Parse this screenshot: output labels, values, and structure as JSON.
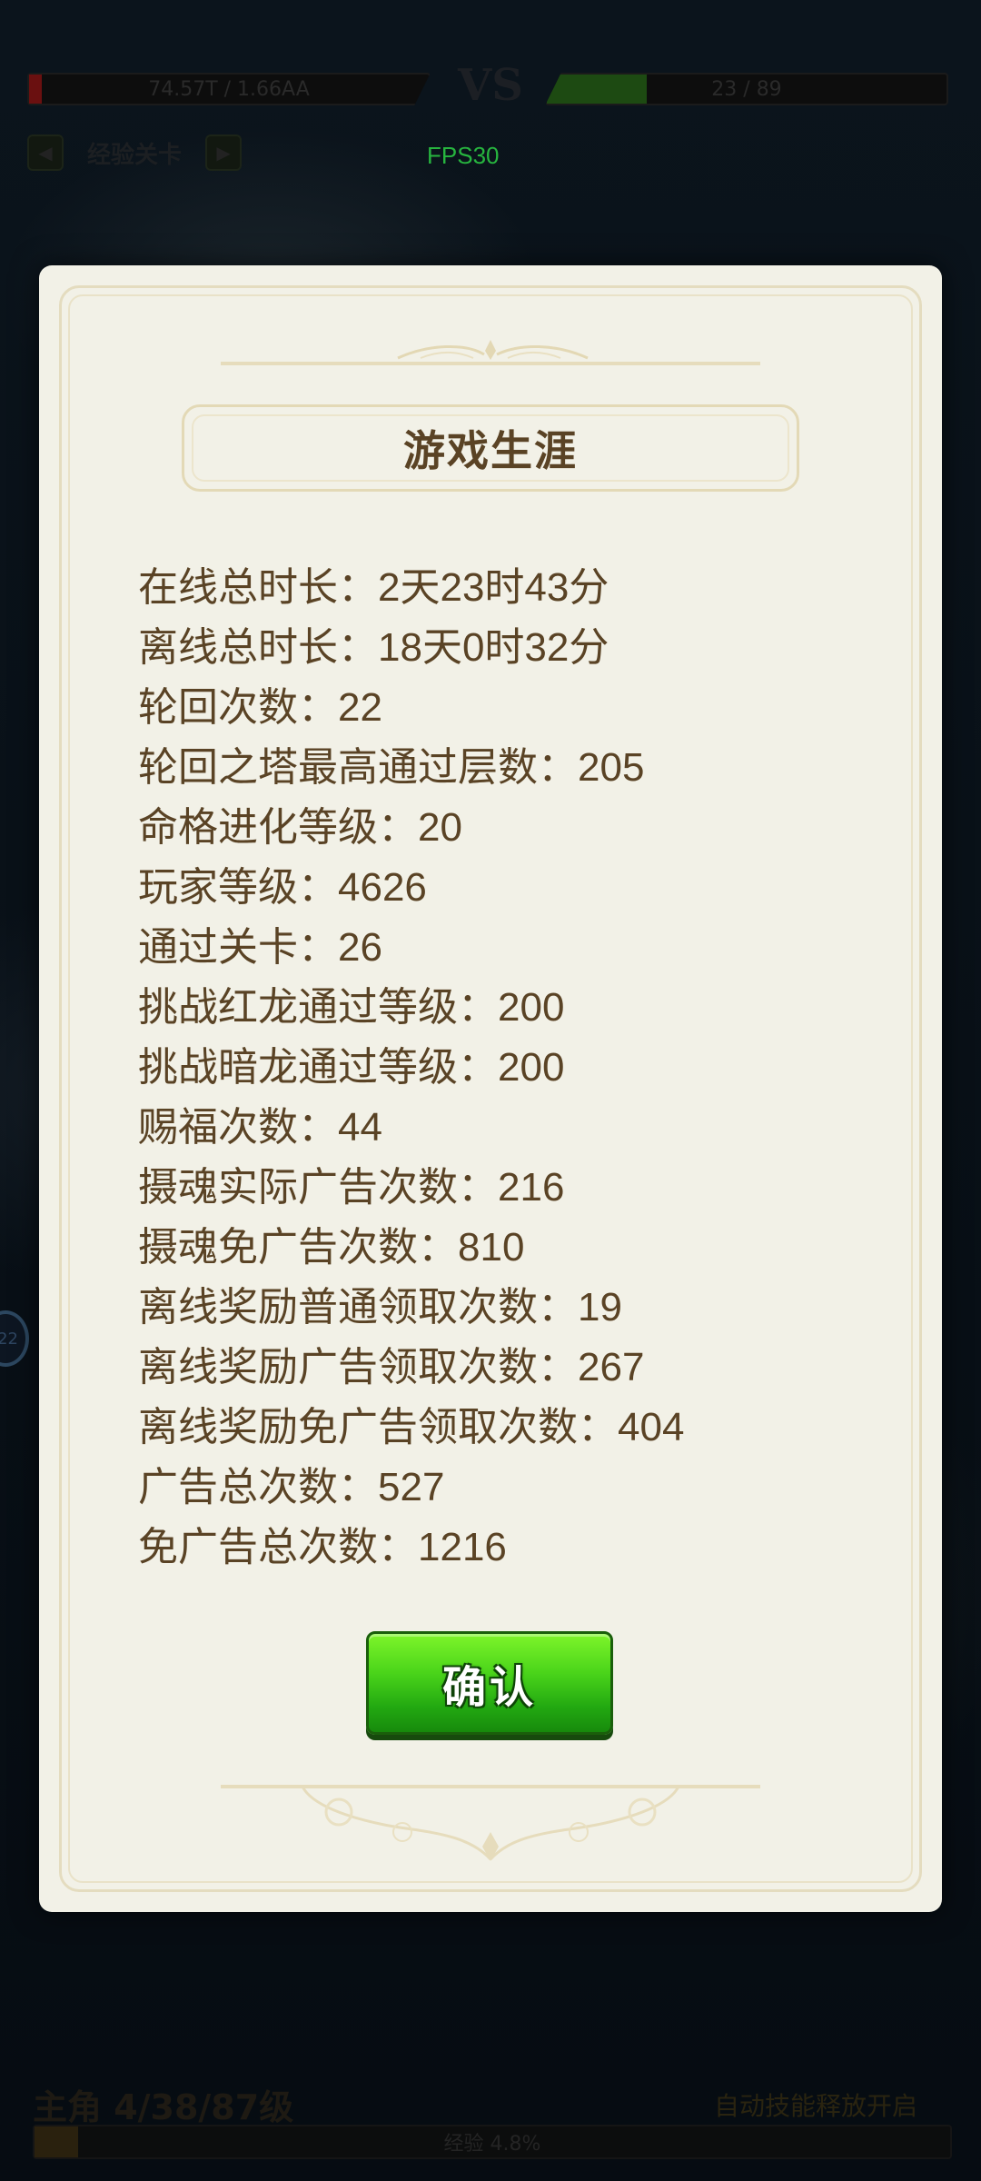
{
  "hud": {
    "player_hp": "74.57T / 1.66AA",
    "vs_label": "VS",
    "enemy_hp": "23 / 89",
    "stage_label": "经验关卡",
    "fps": "FPS30",
    "side_badge": "22",
    "bottom_left": "主角 4/38/87级",
    "bottom_right": "自动技能释放开启",
    "exp_label": "经验 4.8%"
  },
  "dialog": {
    "title": "游戏生涯",
    "stats": [
      {
        "label": "在线总时长：",
        "value": "2天23时43分"
      },
      {
        "label": "离线总时长：",
        "value": "18天0时32分"
      },
      {
        "label": "轮回次数：",
        "value": "22"
      },
      {
        "label": "轮回之塔最高通过层数：",
        "value": "205"
      },
      {
        "label": "命格进化等级：",
        "value": "20"
      },
      {
        "label": "玩家等级：",
        "value": "4626"
      },
      {
        "label": "通过关卡：",
        "value": "26"
      },
      {
        "label": "挑战红龙通过等级：",
        "value": "200"
      },
      {
        "label": "挑战暗龙通过等级：",
        "value": "200"
      },
      {
        "label": "赐福次数：",
        "value": "44"
      },
      {
        "label": "摄魂实际广告次数：",
        "value": "216"
      },
      {
        "label": "摄魂免广告次数：",
        "value": "810"
      },
      {
        "label": "离线奖励普通领取次数：",
        "value": "19"
      },
      {
        "label": "离线奖励广告领取次数：",
        "value": "267"
      },
      {
        "label": "离线奖励免广告领取次数：",
        "value": "404"
      },
      {
        "label": "广告总次数：",
        "value": "527"
      },
      {
        "label": "免广告总次数：",
        "value": "1216"
      }
    ],
    "confirm_label": "确认"
  },
  "colors": {
    "panel_bg": "#f2f1e7",
    "text_brown": "#5a4325",
    "button_green": "#4ad41a",
    "fps_green": "#27b53f"
  }
}
